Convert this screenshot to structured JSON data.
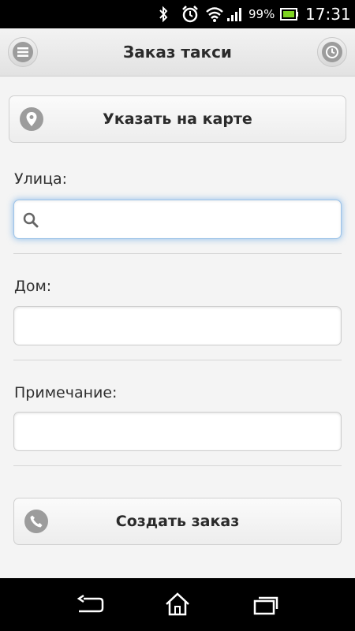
{
  "status_bar": {
    "battery_percent": "99%",
    "time": "17:31",
    "icons": [
      "bluetooth-icon",
      "alarm-icon",
      "wifi-icon",
      "signal-icon",
      "battery-icon"
    ]
  },
  "header": {
    "title": "Заказ такси",
    "left_icon": "menu-icon",
    "right_icon": "clock-icon"
  },
  "map_button": {
    "label": "Указать на карте",
    "icon": "location-pin-icon"
  },
  "form": {
    "street_label": "Улица:",
    "street_value": "",
    "street_icon": "search-icon",
    "house_label": "Дом:",
    "house_value": "",
    "note_label": "Примечание:",
    "note_value": ""
  },
  "create_button": {
    "label": "Создать заказ",
    "icon": "phone-icon"
  },
  "nav_bar": {
    "icons": [
      "back-icon",
      "home-icon",
      "recent-apps-icon"
    ]
  },
  "colors": {
    "header_bg": "#e8e8e8",
    "page_bg": "#f4f4f4",
    "icon_gray": "#9c9c9c",
    "focus_glow": "#5aa0e6",
    "system_bar": "#000000"
  }
}
